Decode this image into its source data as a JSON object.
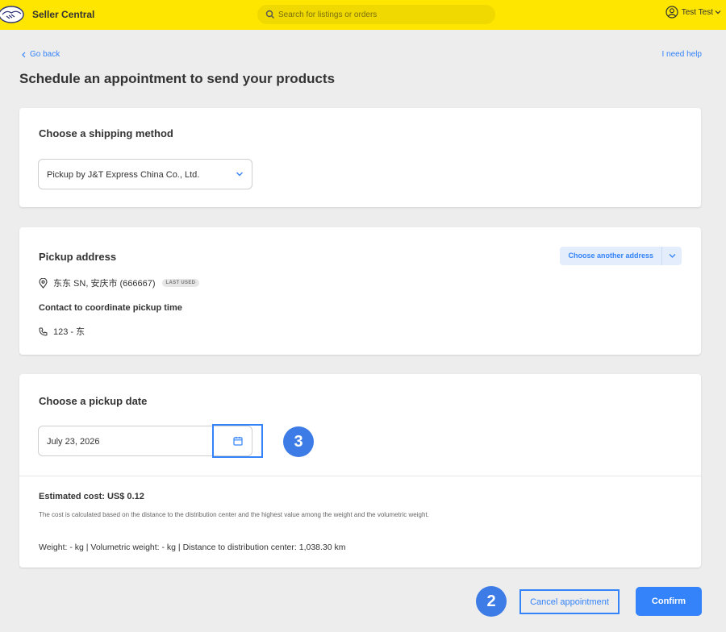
{
  "header": {
    "brand": "Seller Central",
    "search_placeholder": "Search for listings or orders",
    "user_name": "Test Test"
  },
  "nav": {
    "go_back": "Go back",
    "help": "I need help"
  },
  "page_title": "Schedule an appointment to send your products",
  "shipping": {
    "title": "Choose a shipping method",
    "selected_method": "Pickup by J&T Express China Co., Ltd."
  },
  "address": {
    "title": "Pickup address",
    "choose_another": "Choose another address",
    "address_text": "东东 SN, 安庆市 (666667)",
    "badge": "LAST USED",
    "contact_label": "Contact to coordinate pickup time",
    "phone": "123 - 东"
  },
  "pickup_date": {
    "title": "Choose a pickup date",
    "date_value": "July 23, 2026",
    "step_badge": "3"
  },
  "cost": {
    "title": "Estimated cost: US$ 0.12",
    "note": "The cost is calculated based on the distance to the distribution center and the highest value among the weight and the volumetric weight.",
    "weights": "Weight: - kg | Volumetric weight: - kg | Distance to distribution center: 1,038.30 km"
  },
  "actions": {
    "step_badge": "2",
    "cancel": "Cancel appointment",
    "confirm": "Confirm"
  },
  "colors": {
    "header_bg": "#ffe600",
    "accent": "#3483fa",
    "step_badge": "#3d7be6"
  }
}
